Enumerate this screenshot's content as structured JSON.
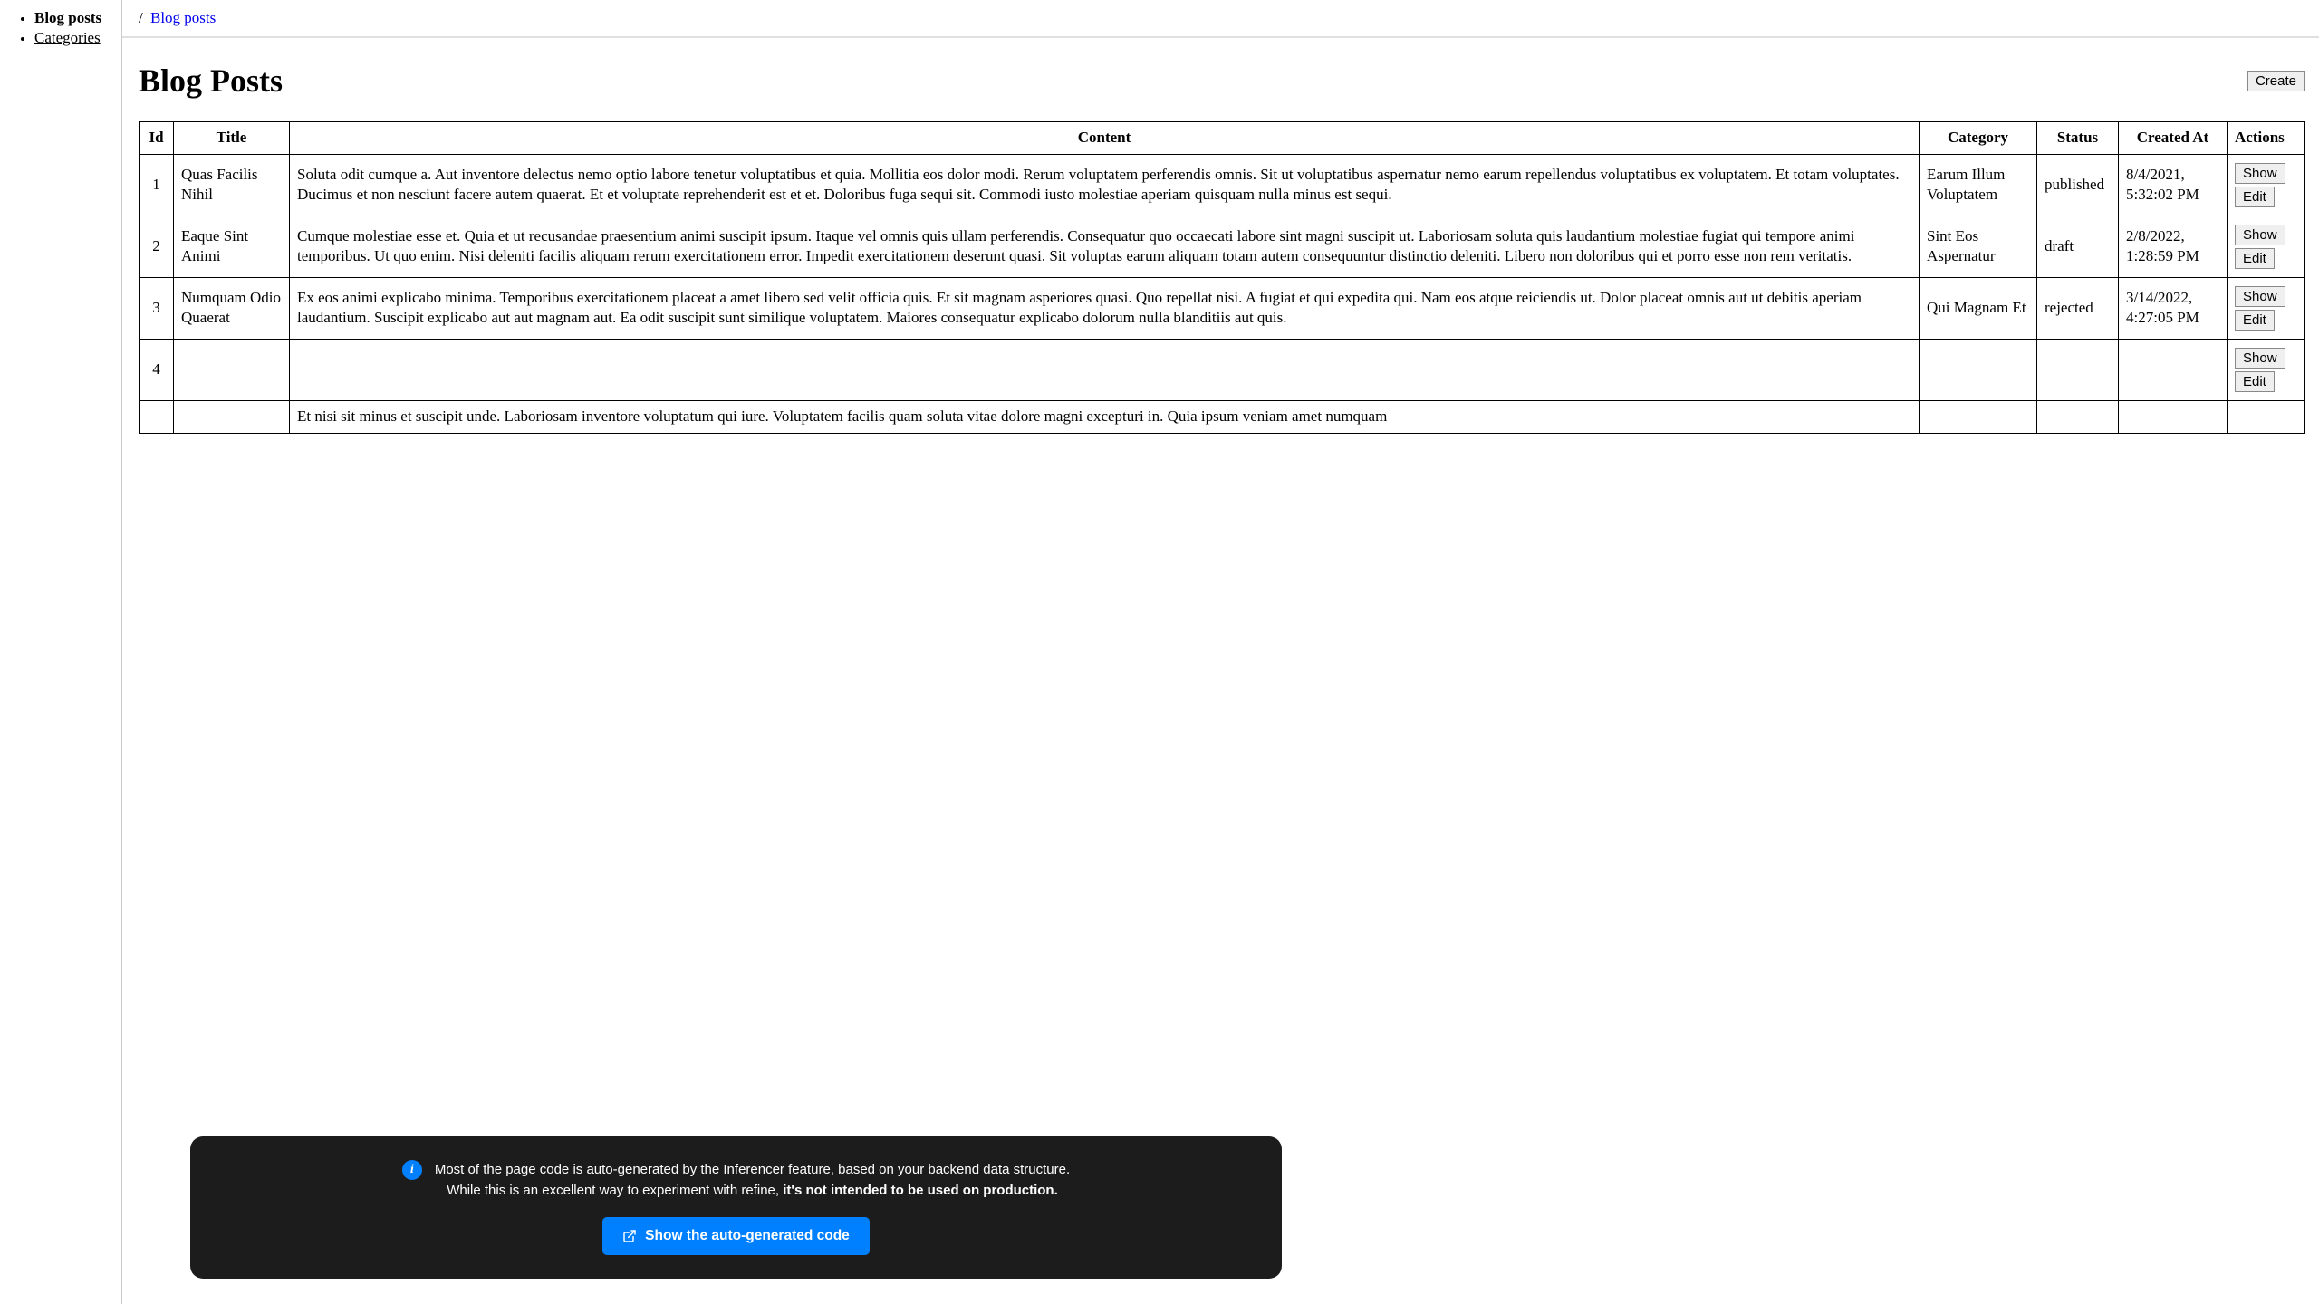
{
  "sidebar": {
    "items": [
      {
        "label": "Blog posts",
        "active": true
      },
      {
        "label": "Categories",
        "active": false
      }
    ]
  },
  "breadcrumb": {
    "sep": "/",
    "current": "Blog posts"
  },
  "header": {
    "title": "Blog Posts",
    "create_label": "Create"
  },
  "table": {
    "columns": {
      "id": "Id",
      "title": "Title",
      "content": "Content",
      "category": "Category",
      "status": "Status",
      "created": "Created At",
      "actions": "Actions"
    },
    "action_labels": {
      "show": "Show",
      "edit": "Edit"
    },
    "rows": [
      {
        "id": "1",
        "title": "Quas Facilis Nihil",
        "content": "Soluta odit cumque a. Aut inventore delectus nemo optio labore tenetur voluptatibus et quia. Mollitia eos dolor modi. Rerum voluptatem perferendis omnis. Sit ut voluptatibus aspernatur nemo earum repellendus voluptatibus ex voluptatem. Et totam voluptates. Ducimus et non nesciunt facere autem quaerat. Et et voluptate reprehenderit est et et. Doloribus fuga sequi sit. Commodi iusto molestiae aperiam quisquam nulla minus est sequi.",
        "category": "Earum Illum Voluptatem",
        "status": "published",
        "created": "8/4/2021, 5:32:02 PM"
      },
      {
        "id": "2",
        "title": "Eaque Sint Animi",
        "content": "Cumque molestiae esse et. Quia et ut recusandae praesentium animi suscipit ipsum. Itaque vel omnis quis ullam perferendis. Consequatur quo occaecati labore sint magni suscipit ut. Laboriosam soluta quis laudantium molestiae fugiat qui tempore animi temporibus. Ut quo enim. Nisi deleniti facilis aliquam rerum exercitationem error. Impedit exercitationem deserunt quasi. Sit voluptas earum aliquam totam autem consequuntur distinctio deleniti. Libero non doloribus qui et porro esse non rem veritatis.",
        "category": "Sint Eos Aspernatur",
        "status": "draft",
        "created": "2/8/2022, 1:28:59 PM"
      },
      {
        "id": "3",
        "title": "Numquam Odio Quaerat",
        "content": "Ex eos animi explicabo minima. Temporibus exercitationem placeat a amet libero sed velit officia quis. Et sit magnam asperiores quasi. Quo repellat nisi. A fugiat et qui expedita qui. Nam eos atque reiciendis ut. Dolor placeat omnis aut ut debitis aperiam laudantium. Suscipit explicabo aut aut magnam aut. Ea odit suscipit sunt similique voluptatem. Maiores consequatur explicabo dolorum nulla blanditiis aut quis.",
        "category": "Qui Magnam Et",
        "status": "rejected",
        "created": "3/14/2022, 4:27:05 PM"
      },
      {
        "id": "4",
        "title": "",
        "content": "",
        "category": "",
        "status": "",
        "created": ""
      },
      {
        "id": "",
        "title": "",
        "content": "Et nisi sit minus et suscipit unde. Laboriosam inventore voluptatum qui iure. Voluptatem facilis quam soluta vitae dolore magni excepturi in. Quia ipsum veniam amet numquam",
        "category": "",
        "status": "",
        "created": ""
      }
    ]
  },
  "toast": {
    "line1_pre": "Most of the page code is auto-generated by the ",
    "line1_link": "Inferencer",
    "line1_post": " feature, based on your backend data structure.",
    "line2_pre": "While this is an excellent way to experiment with refine, ",
    "line2_bold": "it's not intended to be used on production.",
    "button_label": "Show the auto-generated code"
  }
}
